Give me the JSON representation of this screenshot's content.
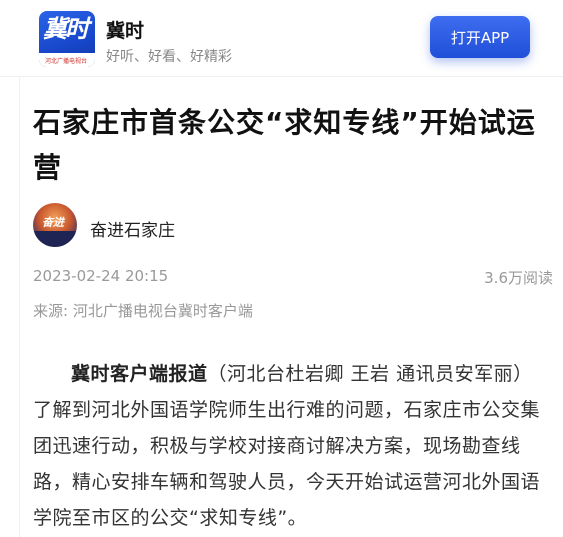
{
  "banner": {
    "app_name": "冀时",
    "slogan": "好听、好看、好精彩",
    "logo_text": "冀时",
    "logo_subtext": "河北广播电视台",
    "open_button": "打开APP",
    "accent_color": "#1f4fd8"
  },
  "article": {
    "title": "石家庄市首条公交“求知专线”开始试运营",
    "author": "奋进石家庄",
    "avatar_text": "奋进",
    "publish_time": "2023-02-24 20:15",
    "read_count": "3.6万阅读",
    "source": "来源: 河北广播电视台冀时客户端",
    "lead": "冀时客户端报道",
    "body": "（河北台杜岩卿 王岩 通讯员安军丽）了解到河北外国语学院师生出行难的问题，石家庄市公交集团迅速行动，积极与学校对接商讨解决方案，现场勘查线路，精心安排车辆和驾驶人员，今天开始试运营河北外国语学院至市区的公交“求知专线”。"
  }
}
